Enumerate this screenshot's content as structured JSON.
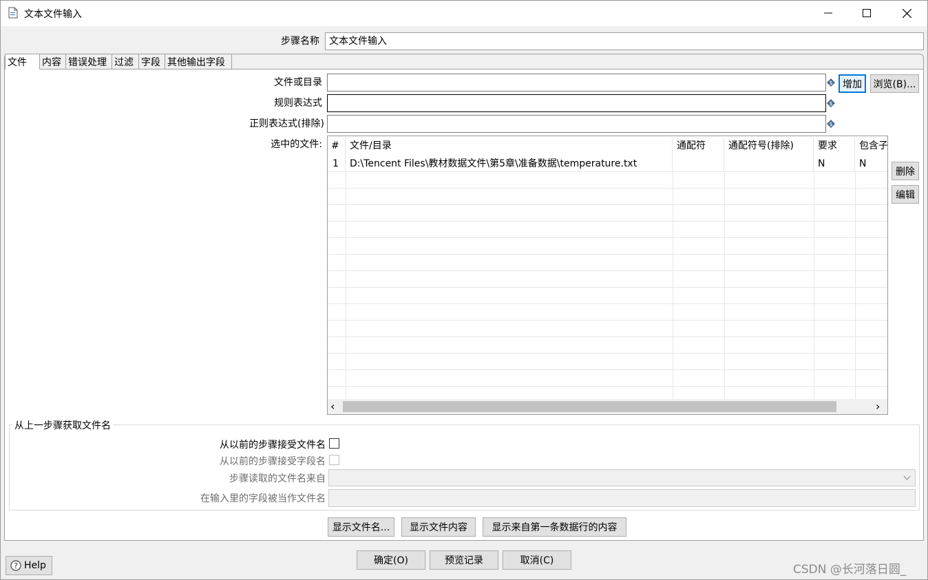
{
  "window": {
    "title": "文本文件输入",
    "minimize_glyph": "—",
    "maximize_glyph": "☐",
    "close_glyph": "✕"
  },
  "step_name": {
    "label": "步骤名称",
    "value": "文本文件输入"
  },
  "tabs": [
    {
      "label": "文件"
    },
    {
      "label": "内容"
    },
    {
      "label": "错误处理"
    },
    {
      "label": "过滤"
    },
    {
      "label": "字段"
    },
    {
      "label": "其他输出字段"
    }
  ],
  "file_tab": {
    "file_or_dir_label": "文件或目录",
    "file_or_dir_value": "",
    "regex_label": "规则表达式",
    "regex_value": "",
    "regex_exclude_label": "正则表达式(排除)",
    "regex_exclude_value": "",
    "add_button": "增加",
    "browse_button": "浏览(B)...",
    "selected_files_label": "选中的文件:",
    "delete_button": "删除",
    "edit_button": "编辑",
    "grid": {
      "columns": [
        "#",
        "文件/目录",
        "通配符",
        "通配符号(排除)",
        "要求",
        "包含子"
      ],
      "rows": [
        [
          "1",
          "D:\\Tencent Files\\教材数据文件\\第5章\\准备数据\\temperature.txt",
          "",
          "",
          "N",
          "N"
        ]
      ],
      "scroll_left": "‹",
      "scroll_right": "›"
    },
    "prev_step_group": {
      "legend": "从上一步骤获取文件名",
      "accept_filenames_label": "从以前的步骤接受文件名",
      "accept_fields_label": "从以前的步骤接受字段名",
      "step_source_label": "步骤读取的文件名来自",
      "field_as_filename_label": "在输入里的字段被当作文件名",
      "accept_filenames_checked": false,
      "accept_fields_checked": false
    },
    "show_filenames_button": "显示文件名...",
    "show_content_button": "显示文件内容",
    "show_first_row_button": "显示来自第一条数据行的内容"
  },
  "footer": {
    "help_button": "Help",
    "ok_button": "确定(O)",
    "preview_button": "预览记录",
    "cancel_button": "取消(C)"
  },
  "watermark": "CSDN @长河落日圆_",
  "colors": {
    "focus_border": "#0078d7",
    "variable_icon": "#4a6a8c"
  },
  "icons": {
    "help": "question-circle-icon",
    "variable": "dollar-diamond-icon"
  }
}
